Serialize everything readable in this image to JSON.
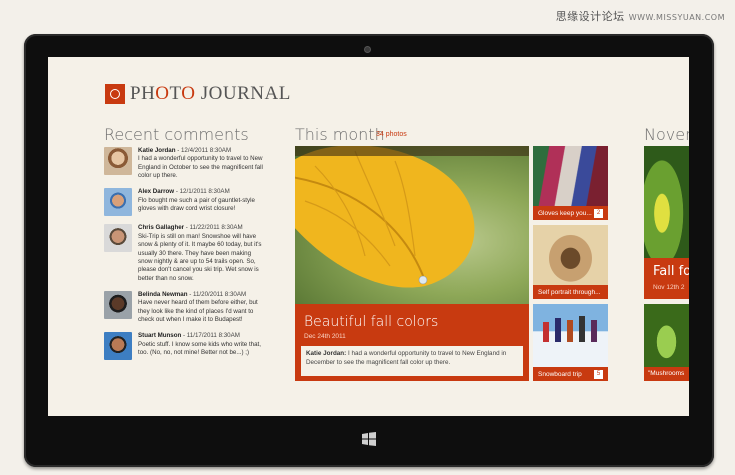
{
  "watermark": {
    "cn": "思缘设计论坛",
    "url": "WWW.MISSYUAN.COM"
  },
  "app": {
    "title_pre": "PH",
    "title_o": "O",
    "title_mid": "T",
    "title_o2": "O",
    "title_post": " JOURNAL"
  },
  "recent": {
    "heading": "Recent comments",
    "items": [
      {
        "name": "Katie Jordan",
        "date": " - 12/4/2011 8:30AM",
        "text": "I had a wonderful opportunity to travel to New England in October to see the magnificent fall color up there."
      },
      {
        "name": "Alex Darrow",
        "date": " - 12/1/2011 8:30AM",
        "text": "Flo bought me such a pair of gauntlet-style gloves with draw cord wrist closure!"
      },
      {
        "name": "Chris Gallagher",
        "date": " - 11/22/2011 8:30AM",
        "text": "Ski-Trip is still on man! Snowshoe will have snow & plenty of it. It maybe 60 today, but it's usually 30 there. They have been making snow nightly & are up to 54 trails open. So, please don't cancel you ski trip. Wet snow is better than no snow."
      },
      {
        "name": "Belinda Newman",
        "date": " - 11/20/2011 8:30AM",
        "text": "Have never heard of them before either, but they look like the kind of places I'd want to check out when I make it to Budapest!"
      },
      {
        "name": "Stuart Munson",
        "date": " - 11/17/2011 8:30AM",
        "text": "Poetic stuff. I know some kids who write that, too. (No, no, not mine! Better not be...) ;)"
      }
    ]
  },
  "month": {
    "heading": "This month",
    "count": "34 photos",
    "feature": {
      "title": "Beautiful fall colors",
      "date": "Dec 24th 2011",
      "comment_name": "Katie Jordan:",
      "comment_text": " I had a wonderful opportunity to travel to New England in December to see the magnificent fall color up there."
    },
    "tiles": [
      {
        "caption": "Gloves keep you...",
        "count": "2"
      },
      {
        "caption": "Self portrait through...",
        "count": ""
      },
      {
        "caption": "Snowboard trip",
        "count": "5"
      }
    ]
  },
  "november": {
    "heading": "Novem",
    "feature_title": "Fall fo",
    "feature_date": "Nov 12th 2",
    "tile_caption": "\"Mushrooms"
  }
}
